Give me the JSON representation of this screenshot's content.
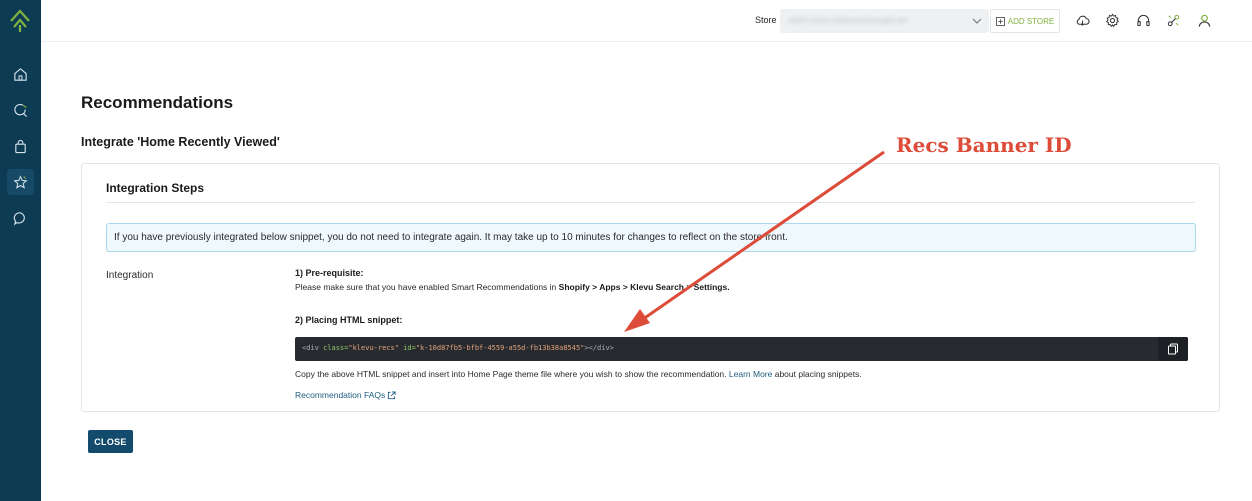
{
  "sidebar": {
    "items": [
      {
        "name": "home-icon"
      },
      {
        "name": "search-icon"
      },
      {
        "name": "shopping-bag-icon"
      },
      {
        "name": "star-icon",
        "active": true
      },
      {
        "name": "chat-icon"
      }
    ]
  },
  "topbar": {
    "store_label": "Store",
    "store_value": "delrtt store heleemuhirrrnpls.wn",
    "add_store_label": "ADD STORE",
    "icons": [
      "cloud-icon",
      "gear-icon",
      "headset-icon",
      "integration-icon",
      "user-icon"
    ]
  },
  "page": {
    "title": "Recommendations",
    "subtitle": "Integrate 'Home Recently Viewed'"
  },
  "card": {
    "title": "Integration Steps",
    "info": "If you have previously integrated below snippet, you do not need to integrate again. It may take up to 10 minutes for changes to reflect on the store front.",
    "integration_label": "Integration",
    "step1_title": "1) Pre-requisite:",
    "step1_prefix": "Please make sure that you have enabled Smart Recommendations in ",
    "step1_path": "Shopify > Apps > Klevu Search > Settings.",
    "step2_title": "2) Placing HTML snippet:",
    "snippet": {
      "open": "<div ",
      "class_attr": "class=",
      "class_val": "\"klevu-recs\"",
      "id_attr": " id=",
      "id_val": "\"k-10d87fb5-bfbf-4559-a55d-fb13b38a8545\"",
      "close": "></div>"
    },
    "copy_text_prefix": "Copy the above HTML snippet and insert into Home Page theme file where you wish to show the recommendation. ",
    "learn_more": "Learn More",
    "copy_text_suffix": " about placing snippets.",
    "faq_link": "Recommendation FAQs"
  },
  "close_label": "CLOSE",
  "annotation": {
    "label": "Recs Banner ID",
    "color": "#dd4b39"
  },
  "colors": {
    "sidebar": "#0e3b54",
    "accent_green": "#7fb23e",
    "primary_button": "#124b6b",
    "link": "#1f5d80"
  }
}
